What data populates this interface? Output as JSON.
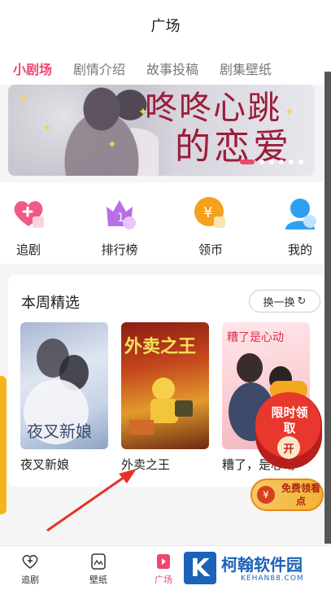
{
  "header": {
    "title": "广场"
  },
  "tabs": [
    {
      "label": "小剧场",
      "active": true
    },
    {
      "label": "剧情介绍",
      "active": false
    },
    {
      "label": "故事投稿",
      "active": false
    },
    {
      "label": "剧集壁纸",
      "active": false
    }
  ],
  "banner": {
    "title_line1": "咚咚心跳",
    "title_line2": "的恋爱",
    "slides": 6,
    "active_slide": 1
  },
  "quick": [
    {
      "label": "追剧",
      "icon": "heart-plus-icon"
    },
    {
      "label": "排行榜",
      "icon": "crown-ranking-icon"
    },
    {
      "label": "领币",
      "icon": "coin-icon"
    },
    {
      "label": "我的",
      "icon": "profile-icon"
    }
  ],
  "picks": {
    "title": "本周精选",
    "shuffle_label": "换一换",
    "items": [
      {
        "title": "夜叉新娘",
        "poster_text": "夜叉新娘"
      },
      {
        "title": "外卖之王",
        "poster_text": "外卖之王"
      },
      {
        "title": "糟了，是心动",
        "poster_text": "糟了是心动"
      }
    ]
  },
  "promo": {
    "text": "限时领取",
    "open_label": "开"
  },
  "coupon": {
    "text": "免费领看点",
    "coin_symbol": "¥"
  },
  "bottom_nav": [
    {
      "label": "追剧",
      "icon": "heart-plus-icon"
    },
    {
      "label": "壁纸",
      "icon": "wallpaper-icon"
    },
    {
      "label": "广场",
      "icon": "square-icon"
    }
  ],
  "watermark": {
    "mark": "K",
    "name": "柯翰软件园",
    "domain": "KEHAN88.COM"
  },
  "colors": {
    "accent": "#f0466e",
    "watermark": "#1a63b8"
  }
}
